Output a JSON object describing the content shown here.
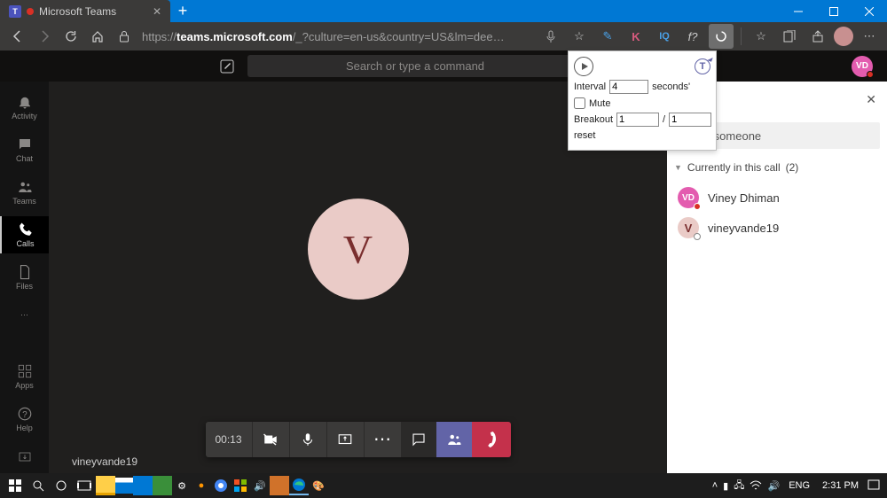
{
  "browser": {
    "tab_title": "Microsoft Teams",
    "url_proto": "https://",
    "url_host": "teams.microsoft.com",
    "url_path": "/_?culture=en-us&country=US&lm=dee…",
    "ext_k": "K",
    "ext_iq": "IQ",
    "ext_fx": "f?"
  },
  "teams": {
    "search_placeholder": "Search or type a command",
    "top_initials": "VD",
    "rail": [
      "Activity",
      "Chat",
      "Teams",
      "Calls",
      "Files",
      "Apps",
      "Help"
    ],
    "caller": "vineyvande19",
    "big_letter": "V",
    "call_time": "00:13"
  },
  "panel": {
    "invite": "Invite someone",
    "section": "Currently in this call",
    "count": "(2)",
    "p1_initials": "VD",
    "p1_name": "Viney Dhiman",
    "p2_initials": "V",
    "p2_name": "vineyvande19"
  },
  "popup": {
    "interval_label": "Interval",
    "interval_value": "4",
    "seconds": "seconds'",
    "mute": "Mute",
    "breakout": "Breakout",
    "b1": "1",
    "b2": "1",
    "reset": "reset",
    "t": "T"
  },
  "taskbar": {
    "lang": "ENG",
    "time": "2:31 PM"
  }
}
